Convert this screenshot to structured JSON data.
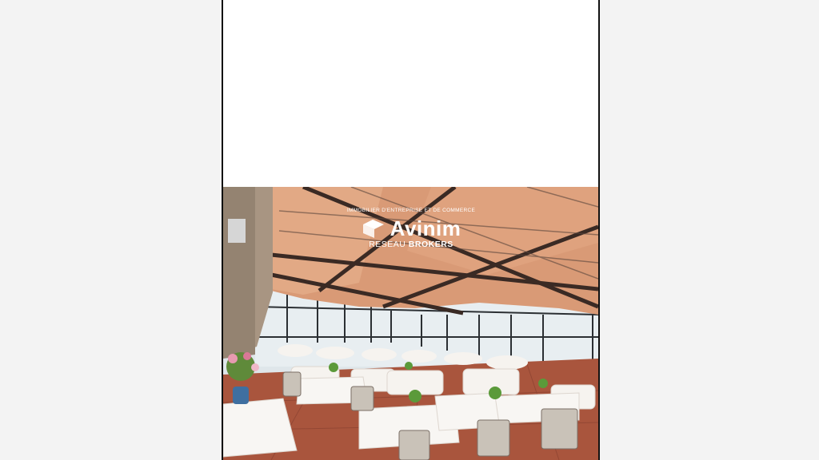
{
  "watermark": {
    "tagline": "IMMOBILIER D'ENTREPRISE ET DE COMMERCE",
    "brand": "Avinim",
    "sub_regular": "RESEAU ",
    "sub_bold": "BROKERS",
    "logo_icon": "avinim-cube-logo"
  },
  "photo": {
    "subject": "restaurant-terrace-dining-room",
    "palette": {
      "awning": "#d99a76",
      "beams": "#3a2a24",
      "tablecloth": "#f6f3ef",
      "floor": "#a9553d",
      "sky": "#dfe6ea"
    }
  }
}
